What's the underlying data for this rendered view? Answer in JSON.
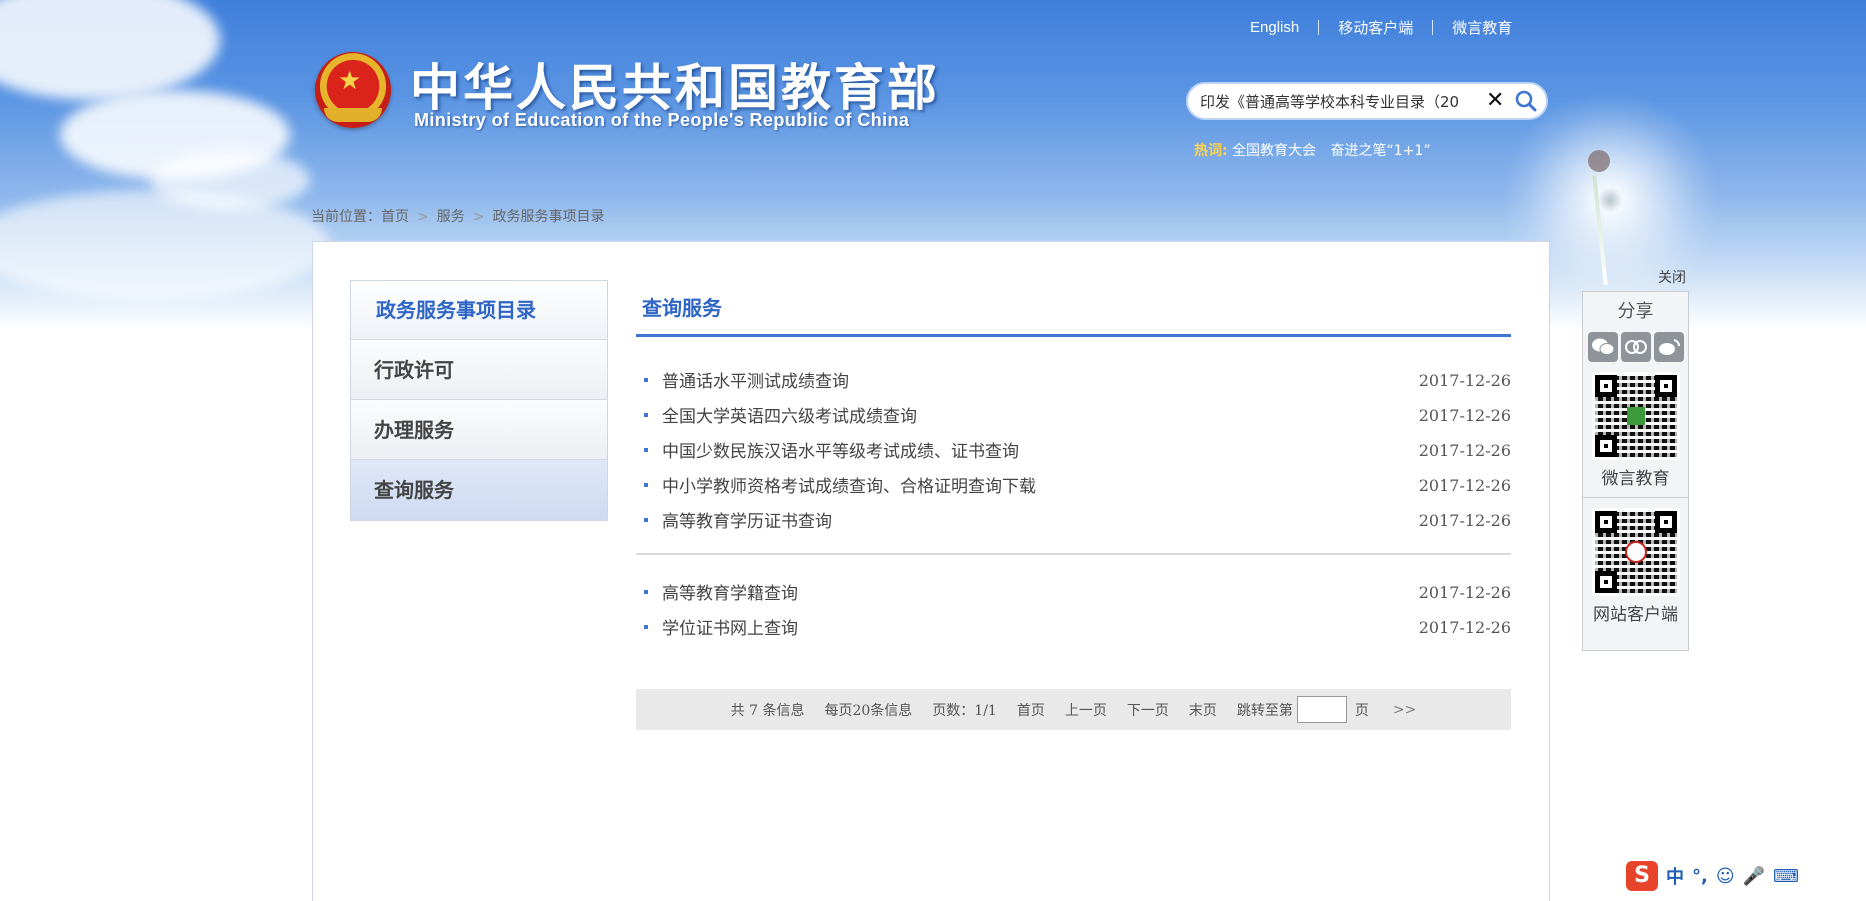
{
  "header": {
    "title_cn": "中华人民共和国教育部",
    "title_en": "Ministry of Education of the People's Republic of China",
    "top_links": [
      "English",
      "移动客户端",
      "微言教育"
    ]
  },
  "search": {
    "value": "印发《普通高等学校本科专业目录（20",
    "clear_icon": "close-icon",
    "submit_icon": "search-icon"
  },
  "hot_words": {
    "label": "热词:",
    "items": [
      "全国教育大会",
      "奋进之笔“1+1”"
    ]
  },
  "breadcrumb": {
    "prefix": "当前位置：",
    "items": [
      "首页",
      "服务",
      "政务服务事项目录"
    ]
  },
  "sidebar": {
    "heading": "政务服务事项目录",
    "items": [
      {
        "label": "行政许可",
        "active": false
      },
      {
        "label": "办理服务",
        "active": false
      },
      {
        "label": "查询服务",
        "active": true
      }
    ]
  },
  "content": {
    "title": "查询服务",
    "group1": [
      {
        "title": "普通话水平测试成绩查询",
        "date": "2017-12-26"
      },
      {
        "title": "全国大学英语四六级考试成绩查询",
        "date": "2017-12-26"
      },
      {
        "title": "中国少数民族汉语水平等级考试成绩、证书查询",
        "date": "2017-12-26"
      },
      {
        "title": "中小学教师资格考试成绩查询、合格证明查询下载",
        "date": "2017-12-26"
      },
      {
        "title": "高等教育学历证书查询",
        "date": "2017-12-26"
      }
    ],
    "group2": [
      {
        "title": "高等教育学籍查询",
        "date": "2017-12-26"
      },
      {
        "title": "学位证书网上查询",
        "date": "2017-12-26"
      }
    ]
  },
  "pager": {
    "total": "共 7 条信息",
    "per_page": "每页20条信息",
    "pages": "页数：1/1",
    "first": "首页",
    "prev": "上一页",
    "next": "下一页",
    "last": "末页",
    "jump_prefix": "跳转至第",
    "jump_suffix": "页",
    "go": ">>"
  },
  "share": {
    "close": "关闭",
    "title": "分享",
    "icons": [
      "wechat-icon",
      "pengyou-icon",
      "weibo-icon"
    ],
    "qr1_label": "微言教育",
    "qr2_label": "网站客户端"
  },
  "ime": {
    "logo": "S",
    "items": [
      "中",
      "°,",
      "☺",
      "🎤",
      "⌨"
    ]
  },
  "colors": {
    "accent": "#2f66c6",
    "sky_top": "#3f7fdc",
    "hot_label": "#ffd34a"
  }
}
